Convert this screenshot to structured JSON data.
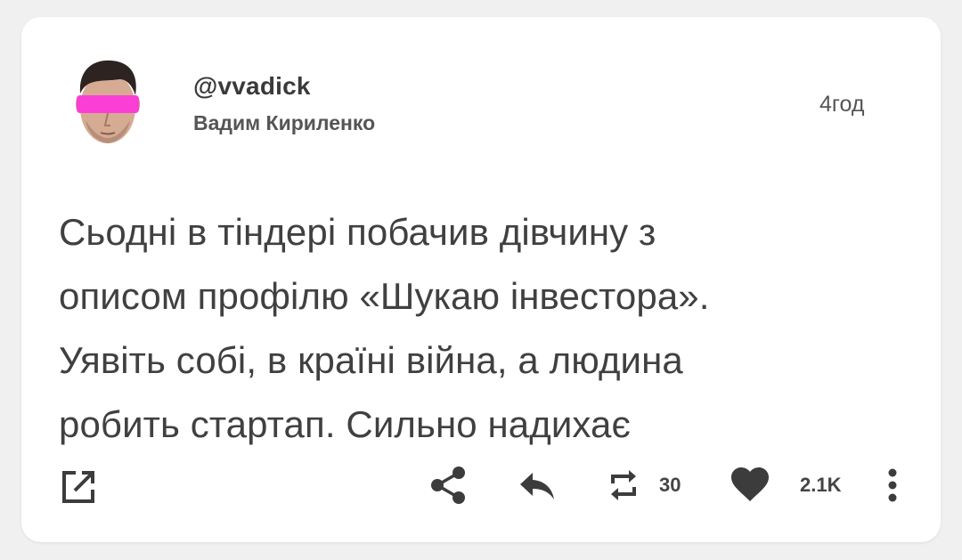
{
  "tweet": {
    "handle": "@vvadick",
    "display_name": "Вадим Кириленко",
    "time": "4год",
    "text": "Сьодні в тіндері побачив дівчину з\nописом профілю «Шукаю інвестора».\nУявіть собі, в країні війна, а людина\nробить стартап. Сильно надихає"
  },
  "actions": {
    "retweet_count": "30",
    "like_count": "2.1K"
  },
  "icons": {
    "open_external": "open-external-icon",
    "share": "share-icon",
    "reply": "reply-icon",
    "retweet": "retweet-icon",
    "like": "heart-icon",
    "more": "more-vertical-icon"
  },
  "colors": {
    "background": "#f0f0f0",
    "card": "#ffffff",
    "text": "#404040",
    "icon": "#3c3c3c",
    "avatar_eye_bar": "#ff33dd"
  }
}
